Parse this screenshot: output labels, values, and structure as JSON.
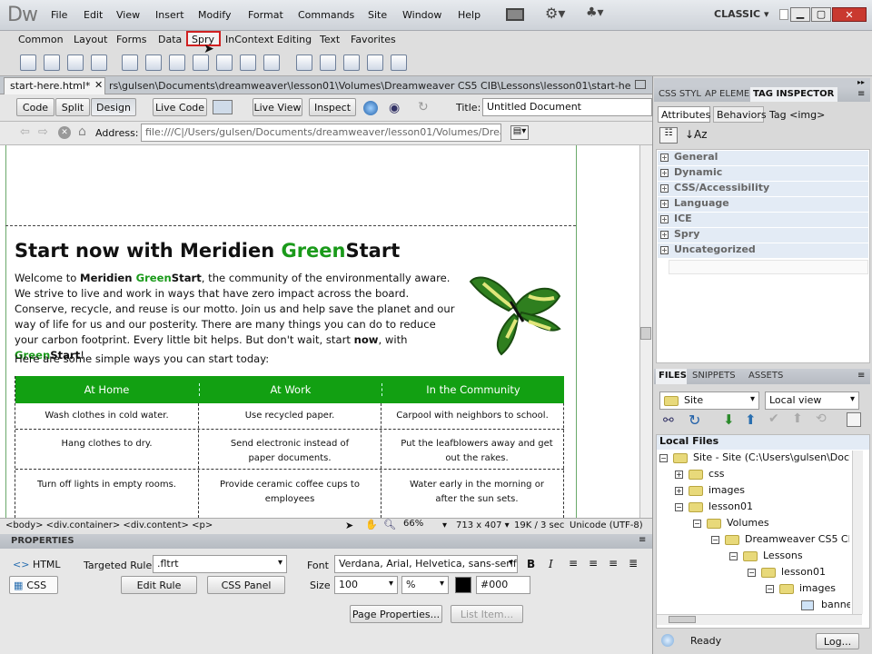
{
  "app": {
    "logo": "Dw",
    "menu": [
      "File",
      "Edit",
      "View",
      "Insert",
      "Modify",
      "Format",
      "Commands",
      "Site",
      "Window",
      "Help"
    ],
    "workspace": "CLASSIC"
  },
  "insert_bar": {
    "tabs": [
      "Common",
      "Layout",
      "Forms",
      "Data",
      "Spry",
      "InContext Editing",
      "Text",
      "Favorites"
    ],
    "active_tab": "Spry"
  },
  "document_tab": {
    "filename": "start-here.html*",
    "path": "rs\\gulsen\\Documents\\dreamweaver\\lesson01\\Volumes\\Dreamweaver CS5 CIB\\Lessons\\lesson01\\start-here.html"
  },
  "doc_toolbar": {
    "code": "Code",
    "split": "Split",
    "design": "Design",
    "live_code": "Live Code",
    "live_view": "Live View",
    "inspect": "Inspect",
    "title_label": "Title:",
    "title_value": "Untitled Document"
  },
  "address_bar": {
    "label": "Address:",
    "value": "file:///C|/Users/gulsen/Documents/dreamweaver/lesson01/Volumes/Dreamwea"
  },
  "page": {
    "heading_plain": "Start now with Meridien ",
    "heading_green": "Green",
    "heading_end": "Start",
    "para1": {
      "t1": "Welcome to ",
      "b1": "Meridien ",
      "g1": "Green",
      "b2": "Start",
      "t2": ", the community of the environmentally aware. We strive to live and work in ways that have zero impact across the board. Conserve, recycle, and reuse is our motto. Join us and help save the planet and our way of life for us and our posterity. There are many things you can do to reduce your carbon footprint. ",
      "b3": "Every little bit helps. But don't wait, start ",
      "b4": "now",
      "b5": ", with ",
      "g2": "Green",
      "b6": "Start",
      "b7": "!"
    },
    "para2": "Here are some simple ways you can start today:",
    "table": {
      "headers": [
        "At Home",
        "At Work",
        "In the Community"
      ],
      "rows": [
        [
          "Wash clothes in cold water.",
          "Use recycled paper.",
          "Carpool with neighbors to school."
        ],
        [
          "Hang clothes to dry.",
          "Send electronic instead of paper documents.",
          "Put the leafblowers away and get out the rakes."
        ],
        [
          "Turn off lights in empty rooms.",
          "Provide ceramic coffee cups to employees",
          "Water early in the morning or after the sun sets."
        ]
      ]
    }
  },
  "status_bar": {
    "tags": "<body> <div.container> <div.content> <p>",
    "zoom": "66%",
    "size": "713 x 407",
    "weight": "19K / 3 sec",
    "encoding": "Unicode (UTF-8)"
  },
  "properties": {
    "title": "PROPERTIES",
    "html_label": "HTML",
    "css_label": "CSS",
    "targeted_rule_label": "Targeted Rule",
    "targeted_rule_value": ".fltrt",
    "edit_rule": "Edit Rule",
    "css_panel": "CSS Panel",
    "font_label": "Font",
    "font_value": "Verdana, Arial, Helvetica, sans-serif",
    "size_label": "Size",
    "size_value": "100",
    "size_unit": "%",
    "color_value": "#000",
    "page_properties": "Page Properties...",
    "list_item": "List Item..."
  },
  "right_panel": {
    "tabs": [
      "CSS STYL",
      "AP ELEME",
      "TAG INSPECTOR"
    ],
    "subtabs": [
      "Attributes",
      "Behaviors"
    ],
    "tag_label": "Tag <img>",
    "categories": [
      "General",
      "Dynamic",
      "CSS/Accessibility",
      "Language",
      "ICE",
      "Spry",
      "Uncategorized"
    ]
  },
  "files_panel": {
    "tabs": [
      "FILES",
      "SNIPPETS",
      "ASSETS"
    ],
    "site_select": "Site",
    "view_select": "Local view",
    "header": "Local Files",
    "tree": [
      {
        "label": "Site - Site (C:\\Users\\gulsen\\Docum",
        "sign": "−"
      },
      {
        "label": "css",
        "sign": "+"
      },
      {
        "label": "images",
        "sign": "+"
      },
      {
        "label": "lesson01",
        "sign": "−"
      },
      {
        "label": "Volumes",
        "sign": "−"
      },
      {
        "label": "Dreamweaver CS5 CIB",
        "sign": "−"
      },
      {
        "label": "Lessons",
        "sign": "−"
      },
      {
        "label": "lesson01",
        "sign": "−"
      },
      {
        "label": "images",
        "sign": "−"
      },
      {
        "label": "banne",
        "sign": ""
      }
    ],
    "status": "Ready",
    "log_button": "Log..."
  },
  "colors": {
    "accent_green": "#1a9a1a",
    "table_header": "#12a012",
    "panel_blue": "#e3ebf5"
  }
}
